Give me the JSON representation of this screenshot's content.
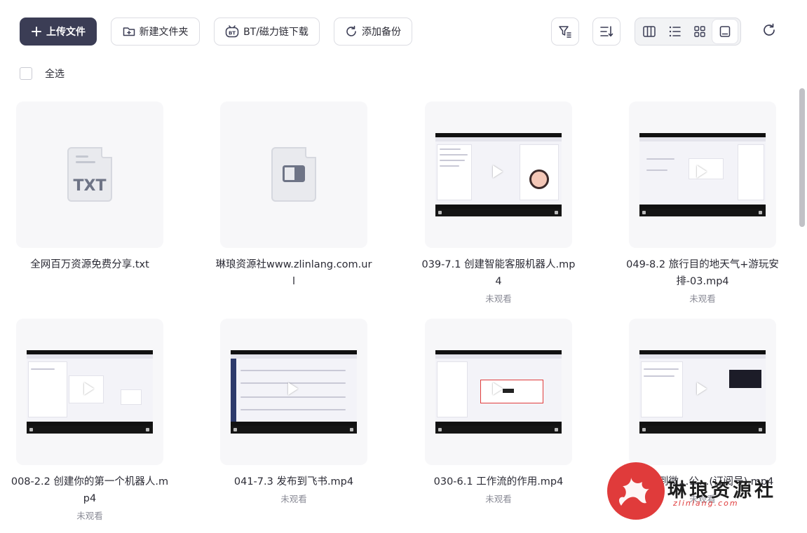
{
  "toolbar": {
    "upload_label": "上传文件",
    "new_folder_label": "新建文件夹",
    "bt_label": "BT/磁力链下载",
    "backup_label": "添加备份",
    "bt_badge": "BT"
  },
  "select_all_label": "全选",
  "files": [
    {
      "name": "全网百万资源免费分享.txt",
      "status": "",
      "type": "txt",
      "icon_text": "TXT"
    },
    {
      "name": "琳琅资源社www.zlinlang.com.url",
      "status": "",
      "type": "url"
    },
    {
      "name": "039-7.1 创建智能客服机器人.mp4",
      "status": "未观看",
      "type": "video"
    },
    {
      "name": "049-8.2 旅行目的地天气+游玩安排-03.mp4",
      "status": "未观看",
      "type": "video"
    },
    {
      "name": "008-2.2 创建你的第一个机器人.mp4",
      "status": "未观看",
      "type": "video"
    },
    {
      "name": "041-7.3 发布到飞书.mp4",
      "status": "未观看",
      "type": "video"
    },
    {
      "name": "030-6.1 工作流的作用.mp4",
      "status": "未观看",
      "type": "video"
    },
    {
      "name": "0…布到微…公…(订阅号).mp4",
      "status": "未观看",
      "type": "video"
    }
  ],
  "watermark": {
    "text": "琳琅资源社",
    "sub": "zlinlang.com"
  },
  "colors": {
    "primary": "#3b3d55",
    "brand_red": "#e03b3b",
    "card_bg": "#f7f7f9"
  }
}
